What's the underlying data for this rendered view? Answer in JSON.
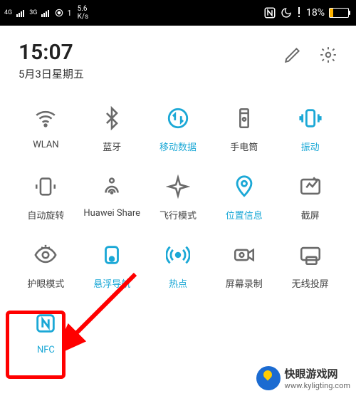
{
  "statusbar": {
    "net1": "4G",
    "net2": "3G",
    "voice_icon": "voice",
    "notif": "1",
    "speed_num": "5.6",
    "speed_unit": "K/s",
    "nfc": "N",
    "dnd": "moon",
    "battery_pct": "18%"
  },
  "header": {
    "time": "15:07",
    "date": "5月3日星期五"
  },
  "tiles": [
    {
      "id": "wlan",
      "label": "WLAN",
      "active": false
    },
    {
      "id": "bluetooth",
      "label": "蓝牙",
      "active": false
    },
    {
      "id": "mobile-data",
      "label": "移动数据",
      "active": true
    },
    {
      "id": "flashlight",
      "label": "手电筒",
      "active": false
    },
    {
      "id": "vibrate",
      "label": "振动",
      "active": true
    },
    {
      "id": "auto-rotate",
      "label": "自动旋转",
      "active": false
    },
    {
      "id": "huawei-share",
      "label": "Huawei Share",
      "active": false
    },
    {
      "id": "airplane",
      "label": "飞行模式",
      "active": false
    },
    {
      "id": "location",
      "label": "位置信息",
      "active": true
    },
    {
      "id": "screenshot",
      "label": "截屏",
      "active": false
    },
    {
      "id": "eye-comfort",
      "label": "护眼模式",
      "active": false
    },
    {
      "id": "float-nav",
      "label": "悬浮导航",
      "active": true
    },
    {
      "id": "hotspot",
      "label": "热点",
      "active": true
    },
    {
      "id": "screen-record",
      "label": "屏幕录制",
      "active": false
    },
    {
      "id": "wireless-cast",
      "label": "无线投屏",
      "active": false
    },
    {
      "id": "nfc",
      "label": "NFC",
      "active": true
    }
  ],
  "watermark": {
    "name": "快眼游戏网",
    "url": "www.kyligting.com"
  }
}
